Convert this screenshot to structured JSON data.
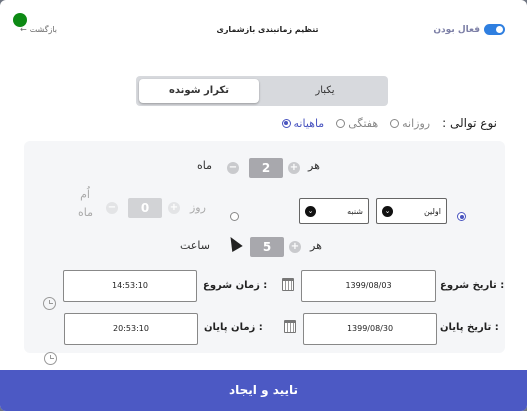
{
  "header": {
    "back_label": "بازگشت",
    "back_icon": "arrow-left-icon",
    "title": "تنظیم زمانبندی بازشماری",
    "active_label": "فعال بودن",
    "active_on": true,
    "status_color": "#0d8a14"
  },
  "mode_tabs": {
    "once": "یکبار",
    "repeating": "تکرار شونده",
    "selected": "repeating"
  },
  "sequence": {
    "label": "نوع توالی :",
    "options": [
      "روزانه",
      "هفتگی",
      "ماهیانه"
    ],
    "selected": "ماهیانه"
  },
  "month_row": {
    "every": "هر",
    "value": "2",
    "unit": "ماه",
    "plus": "+",
    "minus": "−"
  },
  "day_row": {
    "day_value": "0",
    "day_label": "روز",
    "of_month_label": "اُم ماه",
    "week_select": "شنبه",
    "order_select": "اولین",
    "plus": "+",
    "minus": "−"
  },
  "hour_row": {
    "every": "هر",
    "value": "5",
    "unit": "ساعت",
    "plus": "+"
  },
  "dates": {
    "start_date_label": "تاریخ شروع :",
    "start_date": "1399/08/03",
    "end_date_label": "تاریخ پایان :",
    "end_date": "1399/08/30",
    "start_time_label": "زمان شروع :",
    "start_time": "14:53:10",
    "end_time_label": "زمان پایان :",
    "end_time": "20:53:10"
  },
  "submit_label": "تایید و ایجاد",
  "colors": {
    "accent": "#4c59c4",
    "toggle": "#2f7fe0"
  }
}
